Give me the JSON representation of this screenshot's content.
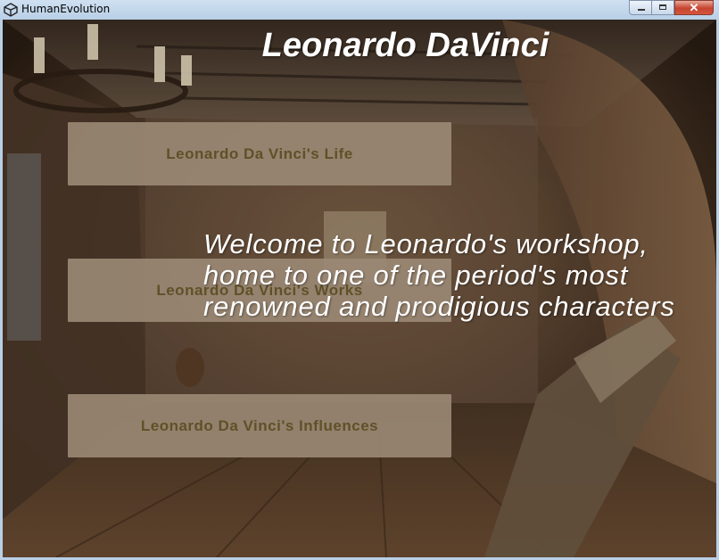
{
  "window": {
    "title": "HumanEvolution",
    "controls": {
      "minimize": "",
      "maximize": "",
      "close": "✕"
    }
  },
  "main": {
    "title": "Leonardo DaVinci",
    "welcome_text": "Welcome to Leonardo's workshop, home to one of the period's most renowned and prodigious characters",
    "buttons": [
      {
        "label": "Leonardo Da Vinci's Life"
      },
      {
        "label": "Leonardo Da Vinci's Works"
      },
      {
        "label": "Leonardo Da Vinci's Influences"
      }
    ]
  },
  "colors": {
    "button_bg": "#9b8a76",
    "button_text": "#5f5128",
    "title_text": "#ffffff"
  },
  "icons": {
    "app": "unity-logo-icon"
  }
}
